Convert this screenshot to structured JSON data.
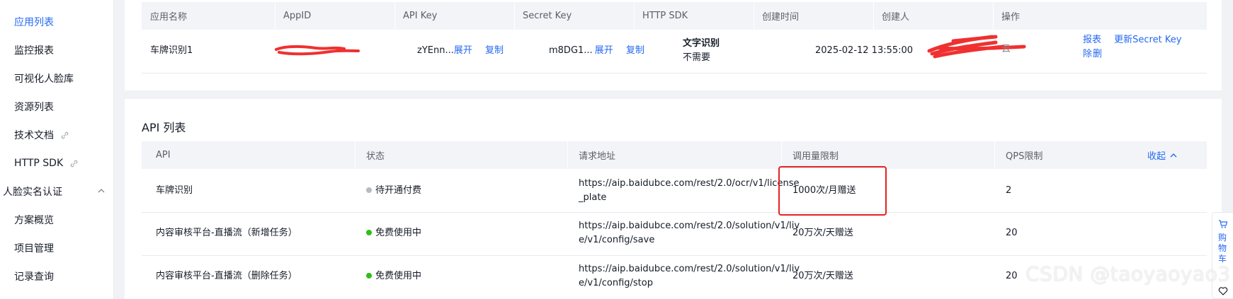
{
  "sidebar": {
    "items": [
      {
        "label": "应用列表"
      },
      {
        "label": "监控报表"
      },
      {
        "label": "可视化人脸库"
      },
      {
        "label": "资源列表"
      },
      {
        "label": "技术文档"
      },
      {
        "label": "HTTP SDK"
      },
      {
        "label": "人脸实名认证"
      },
      {
        "label": "方案概览"
      },
      {
        "label": "项目管理"
      },
      {
        "label": "记录查询"
      }
    ]
  },
  "app_table": {
    "headers": [
      "应用名称",
      "AppID",
      "API Key",
      "Secret Key",
      "HTTP SDK",
      "创建时间",
      "创建人",
      "操作"
    ],
    "row": {
      "name": "车牌识别1",
      "api_key": "zYEnn...",
      "secret_key": "m8DG1...",
      "expand_label": "展开",
      "copy_label": "复制",
      "sdk_name": "文字识别",
      "sdk_status": "不需要",
      "created_time": "2025-02-12 13:55:00",
      "creator_suffix": "云",
      "action_report": "报表",
      "action_update": "更新Secret Key",
      "action_delete_1": "删",
      "action_delete_2": "除"
    }
  },
  "api_section": {
    "title": "API 列表",
    "headers": [
      "API",
      "状态",
      "请求地址",
      "调用量限制",
      "QPS限制"
    ],
    "collapse_label": "收起",
    "rows": [
      {
        "api": "车牌识别",
        "status": "待开通付费",
        "status_color": "#b8babf",
        "url_1": "https://aip.baidubce.com/rest/2.0/ocr/v1/license",
        "url_2": "_plate",
        "limit": "1000次/月赠送",
        "qps": "2"
      },
      {
        "api": "内容审核平台-直播流（新增任务）",
        "status": "免费使用中",
        "status_color": "#30bf13",
        "url_1": "https://aip.baidubce.com/rest/2.0/solution/v1/liv",
        "url_2": "e/v1/config/save",
        "limit": "20万次/天赠送",
        "qps": "20"
      },
      {
        "api": "内容审核平台-直播流（删除任务）",
        "status": "免费使用中",
        "status_color": "#30bf13",
        "url_1": "https://aip.baidubce.com/rest/2.0/solution/v1/liv",
        "url_2": "e/v1/config/stop",
        "limit": "20万次/天赠送",
        "qps": "20"
      }
    ]
  },
  "cart": {
    "label": "购物车"
  },
  "watermark": "CSDN @taoyaoyao3",
  "colors": {
    "accent": "#2468f2",
    "highlight": "#e52222",
    "redaction": "#f03030"
  }
}
